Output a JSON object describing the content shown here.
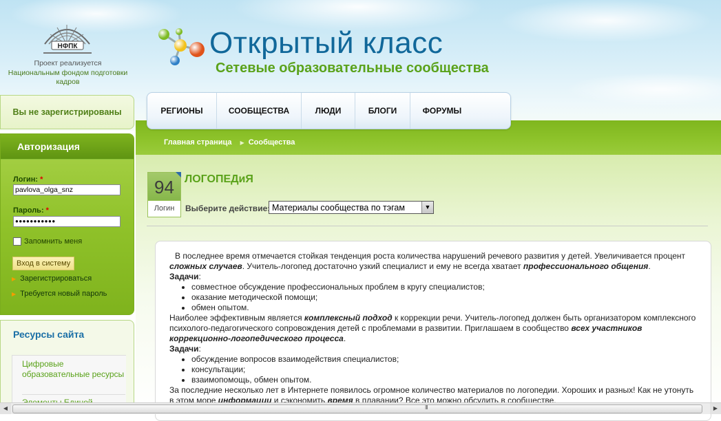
{
  "header": {
    "nfpk_logo_text": "НФПК",
    "nfpk_caption_line1": "Проект реализуется",
    "nfpk_caption_line2": "Национальным фондом подготовки кадров",
    "site_title": "Открытый класс",
    "site_subtitle": "Сетевые образовательные сообщества"
  },
  "nav": {
    "items": [
      "РЕГИОНЫ",
      "СООБЩЕСТВА",
      "ЛЮДИ",
      "БЛОГИ",
      "ФОРУМЫ"
    ]
  },
  "breadcrumb": {
    "home": "Главная страница",
    "current": "Сообщества"
  },
  "sidebar": {
    "not_registered": "Вы не зарегистрированы",
    "auth": {
      "title": "Авторизация",
      "login_label": "Логин:",
      "login_value": "pavlova_olga_snz",
      "password_label": "Пароль:",
      "password_value": "●●●●●●●●●●●",
      "required_mark": "*",
      "remember": "Запомнить меня",
      "login_button": "Вход в систему",
      "register_link": "Зарегистрироваться",
      "new_password_link": "Требуется новый пароль"
    },
    "resources": {
      "title": "Ресурсы сайта",
      "items": [
        "Цифровые образовательные ресурсы",
        "Элементы Единой"
      ]
    }
  },
  "community": {
    "count": "94",
    "count_label": "Логин",
    "title": "ЛОГОПЕДиЯ",
    "action_label": "Выберите действие:",
    "action_selected": "Материалы сообщества по тэгам"
  },
  "content": {
    "intro_1": "В последнее время отмечается стойкая тенденция роста количества нарушений речевого развития у детей. Увеличивается процент ",
    "intro_1_em": "сложных случаев",
    "intro_2": ". Учитель-логопед достаточно узкий специалист и ему не всегда хватает ",
    "intro_2_em": "профессионального общения",
    "intro_end": ".",
    "tasks_label": "Задачи",
    "tasks_colon": ":",
    "tasks_1": [
      "совместное обсуждение профессиональных проблем в кругу специалистов;",
      "оказание методической помощи;",
      "обмен опытом."
    ],
    "para2_1": "Наиболее эффективным является ",
    "para2_1_em": "комплексный подход",
    "para2_2": " к коррекции речи. Учитель-логопед должен быть организатором комплексного психолого-педагогического сопровождения детей с проблемами в развитии. Приглашаем в сообщество ",
    "para2_2_em": "всех участников коррекционно-логопедического процесса",
    "para2_end": ".",
    "tasks_2": [
      "обсуждение вопросов взаимодействия специалистов;",
      "консультации;",
      "взаимопомощь, обмен опытом."
    ],
    "para3_1": "За последние несколько лет в Интернете появилось огромное количество материалов по логопедии. Хороших и разных! Как не утонуть в этом море ",
    "para3_1_em": "информации",
    "para3_2": " и сэкономить ",
    "para3_2_em": "время",
    "para3_3": " в плавании? Все это можно обсудить в сообществе."
  },
  "scrollbar": {
    "grip": "III"
  }
}
